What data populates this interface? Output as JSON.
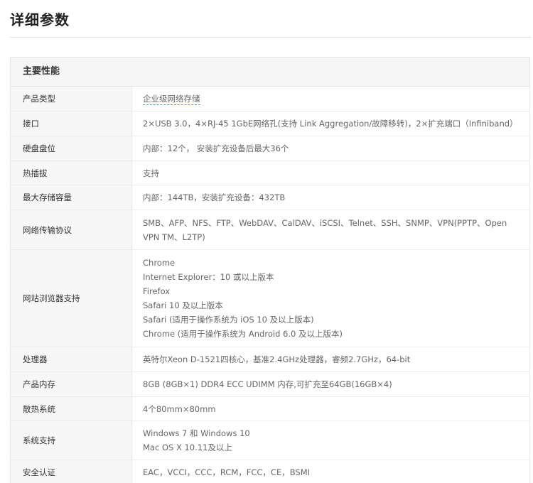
{
  "page_title": "详细参数",
  "section": {
    "title": "主要性能",
    "rows": [
      {
        "label": "产品类型",
        "lines": [
          "企业级网络存储"
        ],
        "link": true,
        "h": 35
      },
      {
        "label": "接口",
        "lines": [
          "2×USB 3.0，4×RJ-45 1GbE网络孔(支持 Link Aggregation/故障移转)，2×扩充端口（Infiniband）"
        ],
        "link": false,
        "h": 35
      },
      {
        "label": "硬盘盘位",
        "lines": [
          "内部：12个， 安装扩充设备后最大36个"
        ],
        "link": false,
        "h": 35
      },
      {
        "label": "热插拔",
        "lines": [
          "支持"
        ],
        "link": false,
        "h": 34
      },
      {
        "label": "最大存储容量",
        "lines": [
          "内部：144TB，安装扩充设备：432TB"
        ],
        "link": false,
        "h": 35
      },
      {
        "label": "网络传输协议",
        "lines": [
          "SMB、AFP、NFS、FTP、WebDAV、CalDAV、iSCSI、Telnet、SSH、SNMP、VPN(PPTP、Open VPN TM、L2TP)"
        ],
        "link": false,
        "h": 56
      },
      {
        "label": "网站浏览器支持",
        "lines": [
          "Chrome",
          "Internet Explorer：10 或以上版本",
          "Firefox",
          "Safari 10 及以上版本",
          "Safari (适用于操作系统为 iOS 10 及以上版本)",
          "Chrome (适用于操作系统为 Android 6.0 及以上版本)"
        ],
        "link": false,
        "h": 137
      },
      {
        "label": "处理器",
        "lines": [
          "英特尔Xeon D-1521四核心，基准2.4GHz处理器，睿频2.7GHz，64-bit"
        ],
        "link": false,
        "h": 35
      },
      {
        "label": "产品内存",
        "lines": [
          "8GB (8GB×1) DDR4 ECC UDIMM 内存,可扩充至64GB(16GB×4)"
        ],
        "link": false,
        "h": 35
      },
      {
        "label": "散热系统",
        "lines": [
          "4个80mm×80mm"
        ],
        "link": false,
        "h": 34
      },
      {
        "label": "系统支持",
        "lines": [
          "Windows 7 和 Windows 10",
          "Mac OS X 10.11及以上"
        ],
        "link": false,
        "h": 55
      },
      {
        "label": "安全认证",
        "lines": [
          "EAC，VCCI，CCC，RCM，FCC，CE，BSMI"
        ],
        "link": false,
        "h": 35
      }
    ]
  }
}
